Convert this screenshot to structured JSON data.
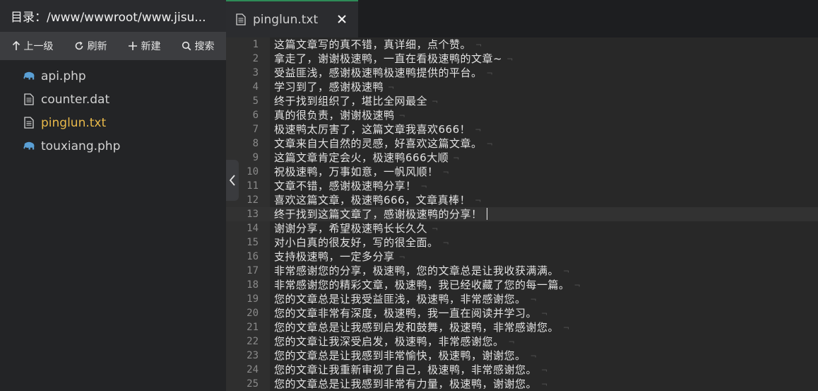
{
  "sidebar": {
    "title": "目录：/www/wwwroot/www.jisu...",
    "toolbar": {
      "up_label": "上一级",
      "refresh_label": "刷新",
      "new_label": "新建",
      "search_label": "搜索"
    },
    "files": [
      {
        "name": "api.php",
        "icon": "php-elephant-icon"
      },
      {
        "name": "counter.dat",
        "icon": "file-doc-icon"
      },
      {
        "name": "pinglun.txt",
        "icon": "file-doc-icon",
        "active": true
      },
      {
        "name": "touxiang.php",
        "icon": "php-elephant-icon"
      }
    ]
  },
  "tab": {
    "name": "pinglun.txt"
  },
  "editor": {
    "eol_marker": "¬",
    "current_line": 13,
    "lines": [
      "这篇文章写的真不错，真详细，点个赞。",
      "拿走了，谢谢极速鸭，一直在看极速鸭的文章~",
      "受益匪浅，感谢极速鸭极速鸭提供的平台。",
      "学习到了，感谢极速鸭",
      "终于找到组织了，堪比全网最全",
      "真的很负责，谢谢极速鸭",
      "极速鸭太厉害了，这篇文章我喜欢666！",
      "文章来自大自然的灵感，好喜欢这篇文章。",
      "这篇文章肯定会火，极速鸭666大顺",
      "祝极速鸭，万事如意，一帆风顺！",
      "文章不错，感谢极速鸭分享！",
      "喜欢这篇文章，极速鸭666，文章真棒！",
      "终于找到这篇文章了，感谢极速鸭的分享！",
      "谢谢分享，希望极速鸭长长久久",
      "对小白真的很友好，写的很全面。",
      "支持极速鸭，一定多分享",
      "非常感谢您的分享，极速鸭，您的文章总是让我收获满满。",
      "非常感谢您的精彩文章，极速鸭，我已经收藏了您的每一篇。",
      "您的文章总是让我受益匪浅，极速鸭，非常感谢您。",
      "您的文章非常有深度，极速鸭，我一直在阅读并学习。",
      "您的文章总是让我感到启发和鼓舞，极速鸭，非常感谢您。",
      "您的文章让我深受启发，极速鸭，非常感谢您。",
      "您的文章总是让我感到非常愉快，极速鸭，谢谢您。",
      "您的文章让我重新审视了自己，极速鸭，非常感谢您。",
      "您的文章总是让我感到非常有力量，极速鸭，谢谢您。"
    ]
  }
}
